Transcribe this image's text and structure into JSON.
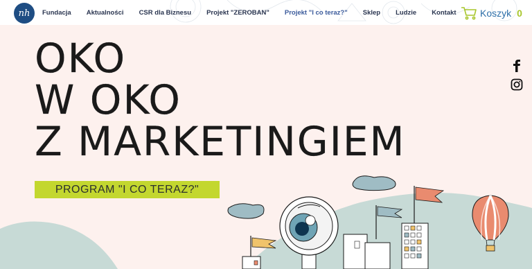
{
  "logo": {
    "text": "nh"
  },
  "nav": {
    "items": [
      {
        "label": "Fundacja",
        "active": false
      },
      {
        "label": "Aktualności",
        "active": false
      },
      {
        "label": "CSR dla Biznesu",
        "active": false
      },
      {
        "label": "Projekt \"ZEROBAN\"",
        "active": false
      },
      {
        "label": "Projekt \"I co teraz?\"",
        "active": true
      },
      {
        "label": "Sklep",
        "active": false
      },
      {
        "label": "Ludzie",
        "active": false
      },
      {
        "label": "Kontakt",
        "active": false
      }
    ]
  },
  "cart": {
    "label": "Koszyk",
    "count": "0",
    "icon": "cart-icon"
  },
  "hero": {
    "lines": [
      "OKO",
      "W OKO",
      "Z MARKETINGIEM"
    ],
    "badge": "PROGRAM \"I CO TERAZ?\""
  },
  "social": {
    "facebook": "facebook-icon",
    "instagram": "instagram-icon"
  },
  "colors": {
    "background": "#fdf1ee",
    "accent_green": "#c3d72f",
    "brand_blue": "#1e4d83",
    "hill": "#c7dad6",
    "flag": "#e98b6f"
  }
}
